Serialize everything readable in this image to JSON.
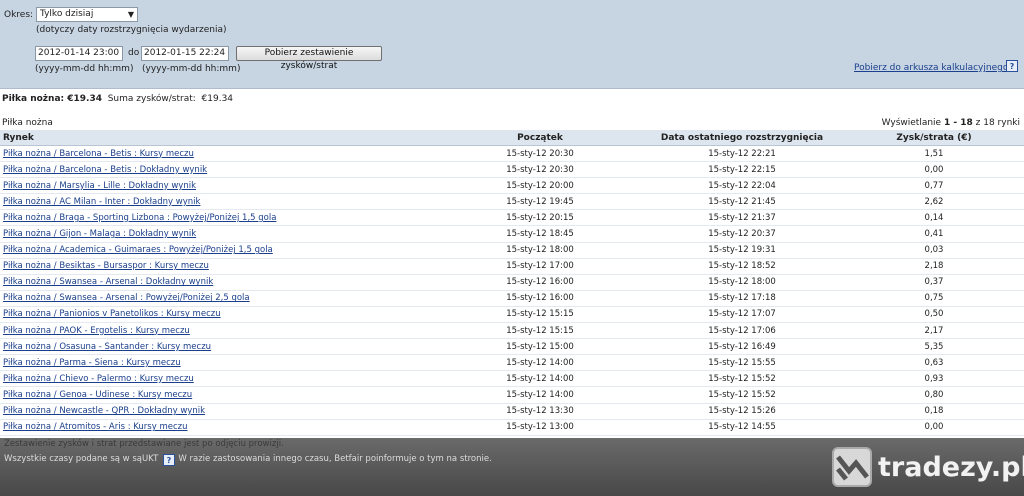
{
  "filter": {
    "period_label": "Okres:",
    "period_value": "Tylko dzisiaj",
    "period_hint": "(dotyczy daty rozstrzygnięcia wydarzenia)",
    "date_from": "2012-01-14 23:00",
    "to_label": "do",
    "date_to": "2012-01-15 22:24",
    "fetch_button": "Pobierz zestawienie zysków/strat",
    "format_hint_from": "(yyyy-mm-dd hh:mm)",
    "format_hint_to": "(yyyy-mm-dd hh:mm)",
    "spreadsheet_link": "Pobierz do arkusza kalkulacyjnego",
    "help_icon": "?"
  },
  "summary": {
    "sport_label": "Piłka nożna: €19.34",
    "total_label": "Suma zysków/strat:",
    "total_value": "€19.34"
  },
  "table": {
    "section_title": "Piłka nożna",
    "paging_prefix": "Wyświetlanie",
    "paging_range": "1 - 18",
    "paging_suffix": "z 18 rynki",
    "headers": [
      "Rynek",
      "Początek",
      "Data ostatniego rozstrzygnięcia",
      "Zysk/strata (€)"
    ],
    "rows": [
      {
        "market": "Piłka nożna / Barcelona - Betis : Kursy meczu",
        "start": "15-sty-12 20:30",
        "settled": "15-sty-12 22:21",
        "pl": "1,51"
      },
      {
        "market": "Piłka nożna / Barcelona - Betis : Dokładny wynik",
        "start": "15-sty-12 20:30",
        "settled": "15-sty-12 22:15",
        "pl": "0,00"
      },
      {
        "market": "Piłka nożna / Marsylia - Lille : Dokładny wynik",
        "start": "15-sty-12 20:00",
        "settled": "15-sty-12 22:04",
        "pl": "0,77"
      },
      {
        "market": "Piłka nożna / AC Milan - Inter : Dokładny wynik",
        "start": "15-sty-12 19:45",
        "settled": "15-sty-12 21:45",
        "pl": "2,62"
      },
      {
        "market": "Piłka nożna / Braga - Sporting Lizbona : Powyżej/Poniżej 1,5 gola",
        "start": "15-sty-12 20:15",
        "settled": "15-sty-12 21:37",
        "pl": "0,14"
      },
      {
        "market": "Piłka nożna / Gijon - Malaga : Dokładny wynik",
        "start": "15-sty-12 18:45",
        "settled": "15-sty-12 20:37",
        "pl": "0,41"
      },
      {
        "market": "Piłka nożna / Academica - Guimaraes : Powyżej/Poniżej 1,5 gola",
        "start": "15-sty-12 18:00",
        "settled": "15-sty-12 19:31",
        "pl": "0,03"
      },
      {
        "market": "Piłka nożna / Besiktas - Bursaspor : Kursy meczu",
        "start": "15-sty-12 17:00",
        "settled": "15-sty-12 18:52",
        "pl": "2,18"
      },
      {
        "market": "Piłka nożna / Swansea - Arsenal : Dokładny wynik",
        "start": "15-sty-12 16:00",
        "settled": "15-sty-12 18:00",
        "pl": "0,37"
      },
      {
        "market": "Piłka nożna / Swansea - Arsenal : Powyżej/Poniżej 2,5 gola",
        "start": "15-sty-12 16:00",
        "settled": "15-sty-12 17:18",
        "pl": "0,75"
      },
      {
        "market": "Piłka nożna / Panionios v Panetolikos : Kursy meczu",
        "start": "15-sty-12 15:15",
        "settled": "15-sty-12 17:07",
        "pl": "0,50"
      },
      {
        "market": "Piłka nożna / PAOK - Ergotelis : Kursy meczu",
        "start": "15-sty-12 15:15",
        "settled": "15-sty-12 17:06",
        "pl": "2,17"
      },
      {
        "market": "Piłka nożna / Osasuna - Santander : Kursy meczu",
        "start": "15-sty-12 15:00",
        "settled": "15-sty-12 16:49",
        "pl": "5,35"
      },
      {
        "market": "Piłka nożna / Parma - Siena : Kursy meczu",
        "start": "15-sty-12 14:00",
        "settled": "15-sty-12 15:55",
        "pl": "0,63"
      },
      {
        "market": "Piłka nożna / Chievo - Palermo : Kursy meczu",
        "start": "15-sty-12 14:00",
        "settled": "15-sty-12 15:52",
        "pl": "0,93"
      },
      {
        "market": "Piłka nożna / Genoa - Udinese : Kursy meczu",
        "start": "15-sty-12 14:00",
        "settled": "15-sty-12 15:52",
        "pl": "0,80"
      },
      {
        "market": "Piłka nożna / Newcastle - QPR : Dokładny wynik",
        "start": "15-sty-12 13:30",
        "settled": "15-sty-12 15:26",
        "pl": "0,18"
      },
      {
        "market": "Piłka nożna / Atromitos - Aris : Kursy meczu",
        "start": "15-sty-12 13:00",
        "settled": "15-sty-12 14:55",
        "pl": "0,00"
      }
    ]
  },
  "footer": {
    "note": "Zestawienie zysków i strat przedstawiane jest po odjęciu prowizji.",
    "timezone_prefix": "Wszystkie czasy podane są w sąUKT",
    "timezone_suffix": "W razie zastosowania innego czasu, Betfair poinformuje o tym na stronie.",
    "help_icon": "?"
  },
  "watermark": {
    "text": "tradezy.pl"
  }
}
